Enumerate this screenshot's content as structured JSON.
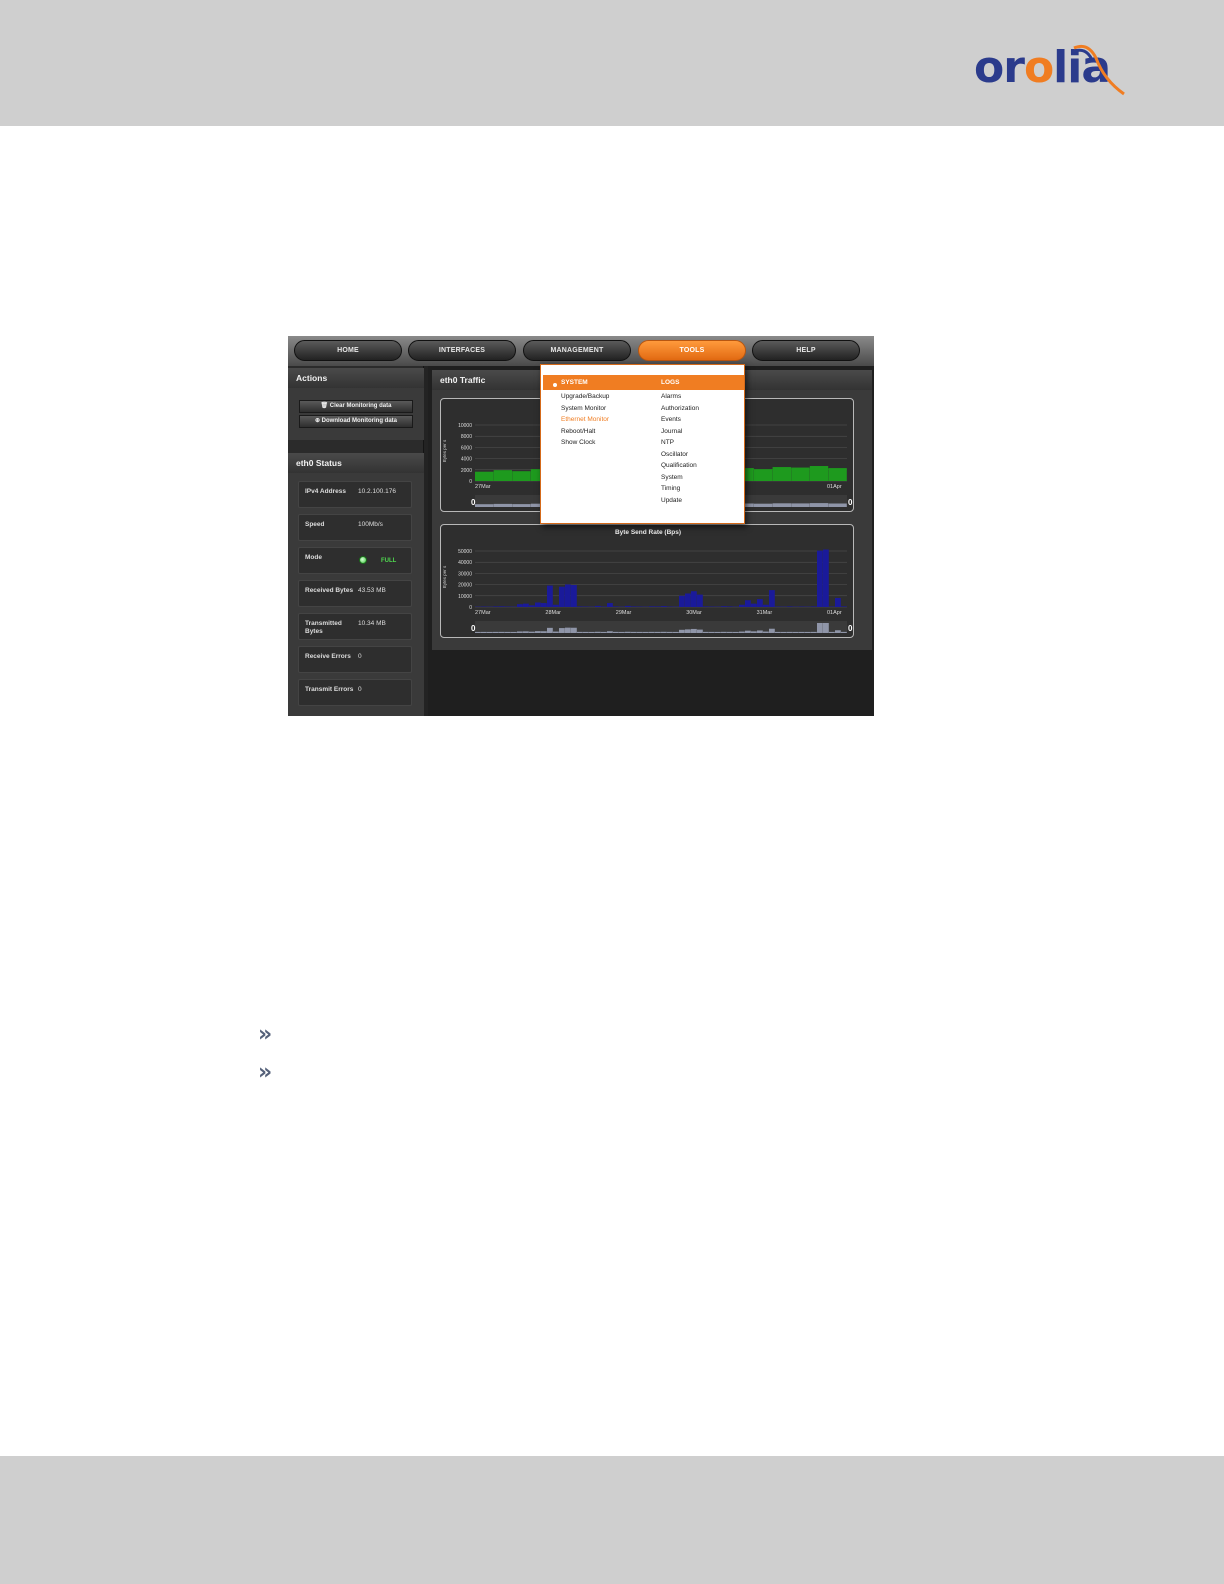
{
  "brand": {
    "name_part1": "or",
    "name_o": "o",
    "name_part2": "lia"
  },
  "nav": {
    "items": [
      {
        "label": "HOME"
      },
      {
        "label": "INTERFACES"
      },
      {
        "label": "MANAGEMENT"
      },
      {
        "label": "TOOLS"
      },
      {
        "label": "HELP"
      }
    ]
  },
  "actions": {
    "title": "Actions",
    "clear_label": "🗑 Clear Monitoring data",
    "download_label": "⊕ Download Monitoring data"
  },
  "status": {
    "title": "eth0 Status",
    "rows": [
      {
        "key": "IPv4 Address",
        "value": "10.2.100.176"
      },
      {
        "key": "Speed",
        "value": "100Mb/s"
      },
      {
        "key": "Mode",
        "value": "FULL"
      },
      {
        "key": "Received Bytes",
        "value": "43.53 MB"
      },
      {
        "key": "Transmitted Bytes",
        "value": "10.34 MB"
      },
      {
        "key": "Receive Errors",
        "value": "0"
      },
      {
        "key": "Transmit Errors",
        "value": "0"
      }
    ]
  },
  "traffic": {
    "title": "eth0 Traffic"
  },
  "tools_menu": {
    "system_label": "SYSTEM",
    "logs_label": "LOGS",
    "system_items": [
      "Upgrade/Backup",
      "System Monitor",
      "Ethernet Monitor",
      "Reboot/Halt",
      "Show Clock"
    ],
    "logs_items": [
      "Alarms",
      "Authorization",
      "Events",
      "Journal",
      "NTP",
      "Oscillator",
      "Qualification",
      "System",
      "Timing",
      "Update"
    ],
    "highlighted": "Ethernet Monitor"
  },
  "bullets": [
    "»",
    "»"
  ],
  "chart_data": [
    {
      "type": "area",
      "title": "",
      "ylabel": "Bytes per s",
      "yticks": [
        "0",
        "2000",
        "4000",
        "6000",
        "8000",
        "10000"
      ],
      "xticks": [
        "27Mar",
        "01Apr"
      ],
      "ylim": [
        0,
        12000
      ],
      "color": "#1e9a1e",
      "navigator_labels": [
        "0",
        "0"
      ],
      "series": [
        {
          "values": [
            1800,
            2100,
            1900,
            2300,
            2000,
            2200,
            1900,
            2100,
            2400,
            2000,
            2300,
            2600,
            2200,
            2800,
            2500,
            2300,
            2700,
            2600,
            2900,
            2500
          ]
        }
      ]
    },
    {
      "type": "area",
      "title": "Byte Send Rate (Bps)",
      "ylabel": "Bytes per s",
      "yticks": [
        "0",
        "10000",
        "20000",
        "30000",
        "40000",
        "50000"
      ],
      "xticks": [
        "27Mar",
        "28Mar",
        "29Mar",
        "30Mar",
        "31Mar",
        "01Apr"
      ],
      "ylim": [
        0,
        55000
      ],
      "color": "#1a1a9a",
      "navigator_labels": [
        "0",
        "0"
      ],
      "series": [
        {
          "values": [
            300,
            400,
            300,
            500,
            600,
            400,
            300,
            2500,
            3000,
            1500,
            4000,
            3500,
            19000,
            2000,
            18000,
            20000,
            19500,
            500,
            400,
            300,
            1000,
            400,
            3500,
            500,
            300,
            1000,
            500,
            400,
            300,
            600,
            500,
            800,
            400,
            300,
            10000,
            12000,
            14000,
            11000,
            500,
            400,
            300,
            700,
            500,
            300,
            2000,
            6000,
            3000,
            7000,
            2000,
            15000,
            400,
            300,
            500,
            300,
            400,
            300,
            500,
            50000,
            51000,
            400,
            8000,
            500
          ]
        }
      ]
    }
  ]
}
